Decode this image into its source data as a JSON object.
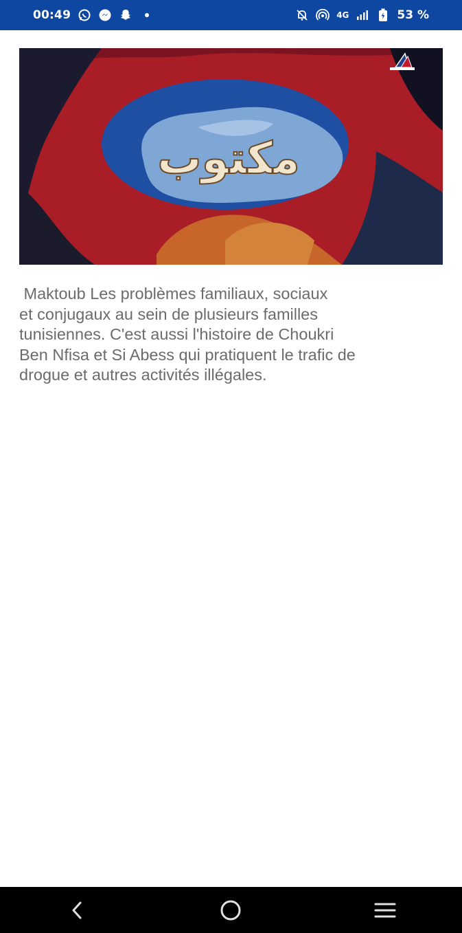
{
  "status_bar": {
    "time": "00:49",
    "network": "4G",
    "battery": "53 %",
    "icons_left": [
      "whatsapp-icon",
      "messenger-icon",
      "snapchat-icon",
      "notification-dot"
    ],
    "icons_right": [
      "mute-icon",
      "hotspot-icon",
      "network-label",
      "signal-icon",
      "battery-icon"
    ],
    "background": "#0d47a1"
  },
  "banner": {
    "image": "show-title-artwork",
    "title_text": "مكتوب",
    "channel_logo": "channel-logo-icon"
  },
  "description": {
    "text": " Maktoub Les problèmes familiaux, sociaux\net conjugaux au sein de plusieurs familles\ntunisiennes. C'est aussi l'histoire de Choukri\nBen Nfisa et Si Abess qui pratiquent le trafic de\ndrogue et autres activités illégales."
  },
  "nav_bar": {
    "buttons": [
      "back-icon",
      "home-icon",
      "recents-icon"
    ]
  }
}
